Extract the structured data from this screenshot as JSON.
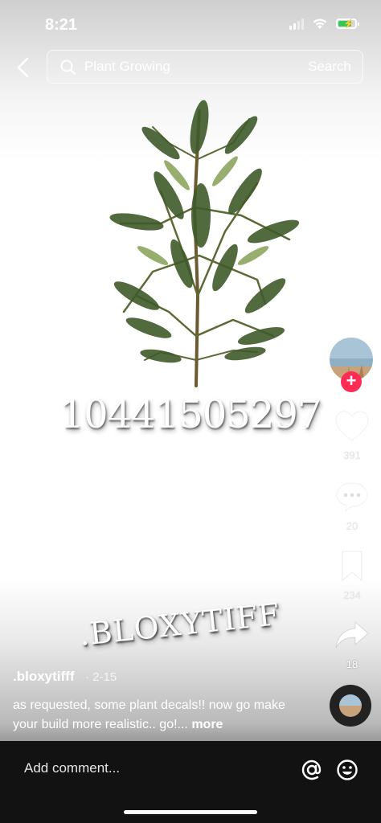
{
  "status_bar": {
    "time": "8:21"
  },
  "search": {
    "query": "Plant Growing",
    "button_label": "Search"
  },
  "video": {
    "overlay_code": "10441505297",
    "watermark": ".BLOXYTIFF"
  },
  "rail": {
    "likes": "391",
    "comments": "20",
    "saves": "234",
    "shares": "18",
    "follow_label": "+"
  },
  "post": {
    "username": ".bloxytifff",
    "date": "· 2-15",
    "caption": "as requested, some plant decals!! now go make your build more realistic.. go!...",
    "more_label": "more"
  },
  "comment_bar": {
    "placeholder": "Add comment..."
  },
  "colors": {
    "follow": "#fe2c55",
    "battery": "#34c759",
    "comment_bar_bg": "#121212"
  },
  "icons": [
    "chevron-left-icon",
    "search-icon",
    "heart-icon",
    "comment-icon",
    "bookmark-icon",
    "share-icon",
    "at-icon",
    "emoji-icon",
    "signal-icon",
    "wifi-icon",
    "battery-icon"
  ]
}
